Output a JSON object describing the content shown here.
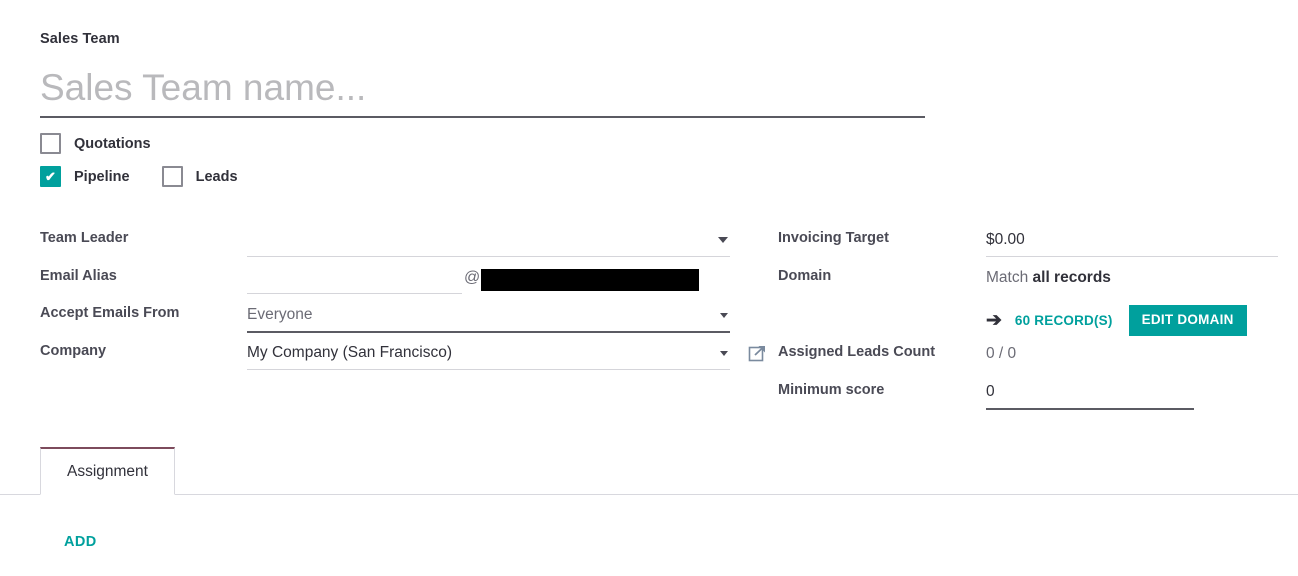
{
  "form": {
    "title_label": "Sales Team",
    "name_placeholder": "Sales Team name...",
    "name_value": ""
  },
  "options": [
    {
      "label": "Quotations",
      "checked": false
    },
    {
      "label": "Pipeline",
      "checked": true
    },
    {
      "label": "Leads",
      "checked": false
    }
  ],
  "left_fields": {
    "team_leader": {
      "label": "Team Leader",
      "value": ""
    },
    "email_alias": {
      "label": "Email Alias",
      "value": "",
      "at_symbol": "@",
      "domain_redacted": true
    },
    "accept_emails_from": {
      "label": "Accept Emails From",
      "value": "Everyone"
    },
    "company": {
      "label": "Company",
      "value": "My Company (San Francisco)"
    }
  },
  "right_fields": {
    "invoicing_target": {
      "label": "Invoicing Target",
      "value": "$0.00"
    },
    "domain": {
      "label": "Domain",
      "match_prefix": "Match ",
      "match_value": "all records",
      "records_link": "60 RECORD(S)",
      "edit_button": "EDIT DOMAIN",
      "arrow_glyph": "➔"
    },
    "assigned_leads_count": {
      "label": "Assigned Leads Count",
      "value": "0 / 0"
    },
    "minimum_score": {
      "label": "Minimum score",
      "value": "0"
    }
  },
  "tabs": [
    {
      "label": "Assignment",
      "active": true
    }
  ],
  "tab_content": {
    "add_label": "ADD"
  },
  "colors": {
    "accent_teal": "#00a09d",
    "tab_active_border": "#7d4b5c",
    "label_gray": "#4a4a55",
    "text_dark": "#31313a",
    "underline_light": "#d5d5da",
    "underline_dark": "#5b5b63"
  }
}
